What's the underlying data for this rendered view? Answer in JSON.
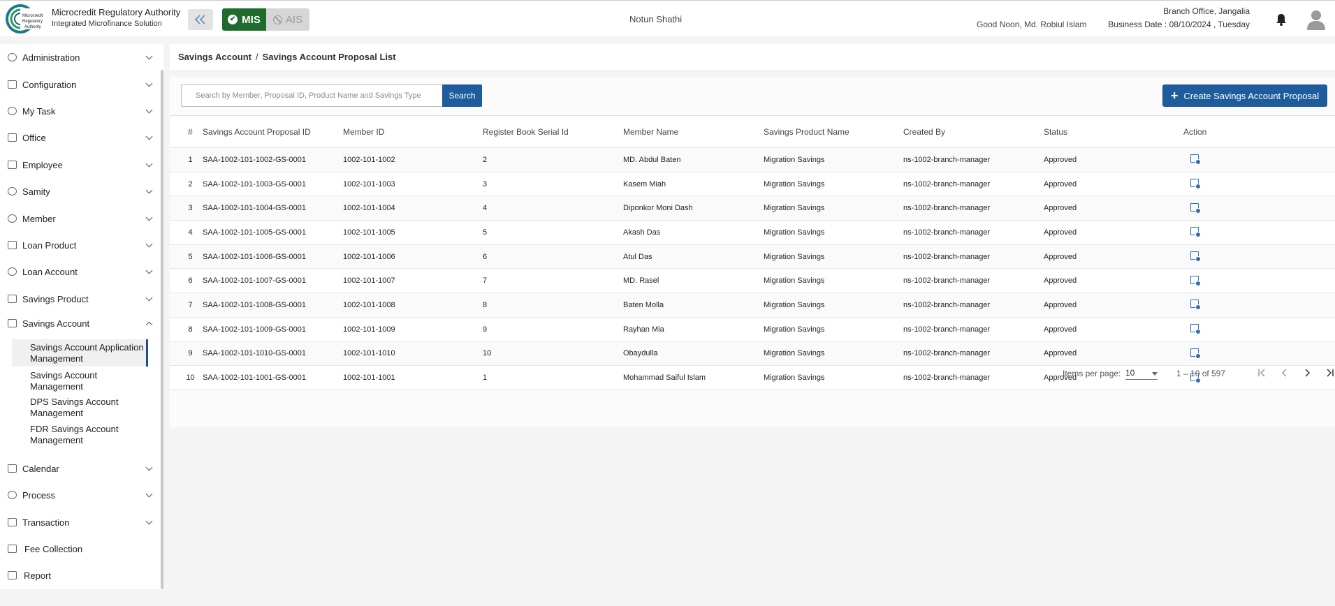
{
  "header": {
    "org_name": "Microcredit Regulatory Authority",
    "org_sub": "Integrated Microfinance Solution",
    "logo_text": "Microcredit Regulatory Authority",
    "mode_mis": "MIS",
    "mode_ais": "AIS",
    "app_center": "Notun Shathi",
    "greeting": "Good Noon, Md. Robiul Islam",
    "branch": "Branch Office, Jangalia",
    "business_date": "Business Date : 08/10/2024 , Tuesday",
    "accent": "#1e5c9b",
    "mis_color": "#1f6b2e"
  },
  "sidebar": {
    "items": [
      {
        "label": "Administration"
      },
      {
        "label": "Configuration"
      },
      {
        "label": "My Task"
      },
      {
        "label": "Office"
      },
      {
        "label": "Employee"
      },
      {
        "label": "Samity"
      },
      {
        "label": "Member"
      },
      {
        "label": "Loan Product"
      },
      {
        "label": "Loan Account"
      },
      {
        "label": "Savings Product"
      },
      {
        "label": "Savings Account"
      },
      {
        "label": "Calendar"
      },
      {
        "label": "Process"
      },
      {
        "label": "Transaction"
      },
      {
        "label": "Fee Collection"
      },
      {
        "label": "Report"
      }
    ],
    "sub_items": [
      {
        "label": "Savings Account Application Management"
      },
      {
        "label": "Savings Account Management"
      },
      {
        "label": "DPS Savings Account Management"
      },
      {
        "label": "FDR Savings Account Management"
      }
    ]
  },
  "breadcrumb": {
    "parent": "Savings Account",
    "separator": "/",
    "current": "Savings Account Proposal List"
  },
  "toolbar": {
    "search_placeholder": "Search by Member, Proposal ID, Product Name and Savings Type",
    "search_label": "Search",
    "create_label": "Create Savings Account Proposal"
  },
  "table": {
    "columns": [
      "#",
      "Savings Account Proposal ID",
      "Member ID",
      "Register Book Serial Id",
      "Member Name",
      "Savings Product Name",
      "Created By",
      "Status",
      "Action"
    ],
    "rows": [
      [
        "1",
        "SAA-1002-101-1002-GS-0001",
        "1002-101-1002",
        "2",
        "MD. Abdul Baten",
        "Migration Savings",
        "ns-1002-branch-manager",
        "Approved"
      ],
      [
        "2",
        "SAA-1002-101-1003-GS-0001",
        "1002-101-1003",
        "3",
        "Kasem Miah",
        "Migration Savings",
        "ns-1002-branch-manager",
        "Approved"
      ],
      [
        "3",
        "SAA-1002-101-1004-GS-0001",
        "1002-101-1004",
        "4",
        "Diponkor Moni Dash",
        "Migration Savings",
        "ns-1002-branch-manager",
        "Approved"
      ],
      [
        "4",
        "SAA-1002-101-1005-GS-0001",
        "1002-101-1005",
        "5",
        "Akash Das",
        "Migration Savings",
        "ns-1002-branch-manager",
        "Approved"
      ],
      [
        "5",
        "SAA-1002-101-1006-GS-0001",
        "1002-101-1006",
        "6",
        "Atul Das",
        "Migration Savings",
        "ns-1002-branch-manager",
        "Approved"
      ],
      [
        "6",
        "SAA-1002-101-1007-GS-0001",
        "1002-101-1007",
        "7",
        "MD. Rasel",
        "Migration Savings",
        "ns-1002-branch-manager",
        "Approved"
      ],
      [
        "7",
        "SAA-1002-101-1008-GS-0001",
        "1002-101-1008",
        "8",
        "Baten Molla",
        "Migration Savings",
        "ns-1002-branch-manager",
        "Approved"
      ],
      [
        "8",
        "SAA-1002-101-1009-GS-0001",
        "1002-101-1009",
        "9",
        "Rayhan Mia",
        "Migration Savings",
        "ns-1002-branch-manager",
        "Approved"
      ],
      [
        "9",
        "SAA-1002-101-1010-GS-0001",
        "1002-101-1010",
        "10",
        "Obaydulla",
        "Migration Savings",
        "ns-1002-branch-manager",
        "Approved"
      ],
      [
        "10",
        "SAA-1002-101-1001-GS-0001",
        "1002-101-1001",
        "1",
        "Mohammad Saiful Islam",
        "Migration Savings",
        "ns-1002-branch-manager",
        "Approved"
      ]
    ]
  },
  "paginator": {
    "label": "Items per page:",
    "page_size": "10",
    "range": "1 – 10 of 597"
  }
}
